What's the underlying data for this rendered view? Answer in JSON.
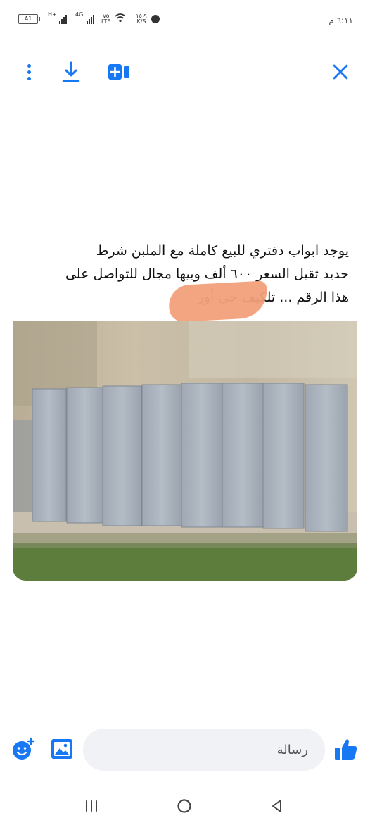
{
  "status_bar": {
    "battery": "A1",
    "network1": "H+",
    "network2": "4G",
    "volte_top": "Vo",
    "volte_bottom": "LTE",
    "speed_value": "١٥٫٩",
    "speed_unit": "K/S",
    "time": "٦:١١ م"
  },
  "toolbar": {
    "icons": [
      "more-vertical-icon",
      "download-icon",
      "add-to-story-icon",
      "close-icon"
    ]
  },
  "message": {
    "line1": "يوجد ابواب دفتري للبيع كاملة مع الملبن شرط",
    "line2": "حديد ثقيل السعر ٦٠٠ ألف وبيها مجال للتواصل على",
    "line3": "هذا الرقم ... تلكيف حي أور"
  },
  "composer": {
    "placeholder": "رسالة"
  },
  "colors": {
    "accent": "#1877f2",
    "redaction": "#f2a07a",
    "input_bg": "#f0f2f5"
  }
}
